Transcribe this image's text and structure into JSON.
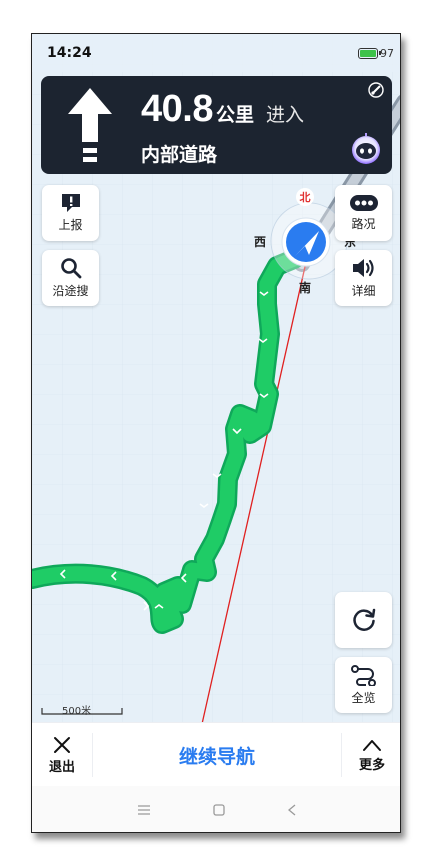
{
  "status_bar": {
    "time": "14:24",
    "battery_percent": "97"
  },
  "nav_banner": {
    "distance": "40.8",
    "unit": "公里",
    "action": "进入",
    "road": "内部道路"
  },
  "compass": {
    "north": "北",
    "south": "南",
    "east": "东",
    "west": "西"
  },
  "left_buttons": {
    "report_label": "上报",
    "search_label": "沿途搜"
  },
  "right_buttons": {
    "traffic_label": "路况",
    "detail_label": "详细",
    "overview_label": "全览"
  },
  "scale": {
    "label": "500米"
  },
  "bottom_bar": {
    "exit_label": "退出",
    "continue_label": "继续导航",
    "more_label": "更多"
  },
  "colors": {
    "route": "#1fcc66",
    "banner": "#1c2430",
    "accent": "#2a7cf0",
    "direct_line": "#e02020"
  },
  "icons": [
    "straight-arrow-icon",
    "gps-signal-icon",
    "assistant-icon",
    "report-icon",
    "search-icon",
    "traffic-icon",
    "volume-icon",
    "refresh-icon",
    "overview-icon",
    "close-icon",
    "chevron-up-icon",
    "menu-icon",
    "home-icon",
    "back-icon"
  ]
}
